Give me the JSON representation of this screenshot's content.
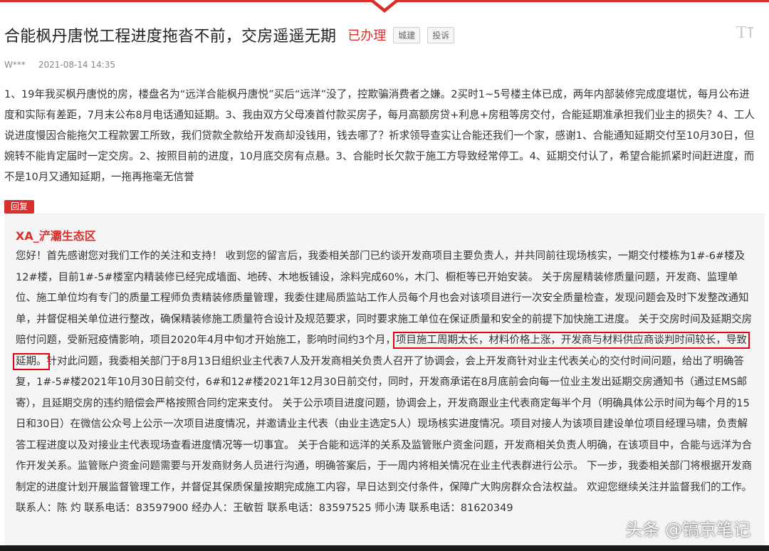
{
  "header": {
    "title": "合能枫丹唐悦工程进度拖沓不前，交房遥遥无期",
    "status": "已办理",
    "tags": [
      "城建",
      "投诉"
    ],
    "font_toggle_label": "T"
  },
  "meta": {
    "author": "W***",
    "timestamp": "2021-08-14 14:35"
  },
  "question": {
    "body": "1、19年我买枫丹唐悦的房，楼盘名为“远洋合能枫丹唐悦”买后“远洋”没了，控欺骗消费者之嫌。2买时1~5号楼主体已成，两年内部装修完成度堪忧，每月公布进度和实际有差距，7月末公布8月电话通知延期。3、我由双方父母凑首付款买房子，每月高额房贷+利息+房租等房交付，合能延期准承担我们业主的损失？4、工人说进度慢因合能拖欠工程款罢工所致，我们贷款全款给开发商却没钱用，钱去哪了？祈求领导查实让合能还我们一个家，感谢1、合能通知延期交付至10月30日，但婉转不能肯定届时一定交房。2、按照目前的进度，10月底交房有点悬。3、合能时长欠款于施工方导致经常停工。4、延期交付认了，希望合能抓紧时间赶进度，而不是10月又通知延期，一拖再拖毫无信誉"
  },
  "reply": {
    "badge": "回复",
    "department": "XA_浐灞生态区",
    "text_before": "您好！首先感谢您对我们工作的关注和支持！ 收到您的留言后，我委相关部门已约谈开发商项目主要负责人，并共同前往现场核实，一期交付楼栋为1#-6#楼及12#楼，目前1#-5#楼室内精装修已经完成墙面、地砖、木地板铺设，涂料完成60%，木门、橱柜等已开始安装。 关于房屋精装修质量问题，开发商、监理单位、施工单位均有专门的质量工程师负责精装修质量管理，我委住建局质监站工作人员每个月也会对该项目进行一次安全质量检查，发现问题会及时下发整改通知单，并督促相关单位进行整改，确保精装修施工质量符合设计及规范要求，同时要求施工单位在保证质量和安全的前提下加快施工进度。 关于交房时间及延期交房赔付问题，受新冠疫情影响，项目2020年4月中旬才开始施工，影响时间约3个月，",
    "text_highlight": "项目施工周期太长，材料价格上涨，开发商与材料供应商谈判时间较长，导致延期。",
    "text_after": "针对此问题，我委相关部门于8月13日组织业主代表7人及开发商相关负责人召开了协调会，会上开发商针对业主代表关心的交付时间问题，给出了明确答复，1#-5#楼2021年10月30日前交付，6#和12#楼2021年12月30日前交付，同时，开发商承诺在8月底前会向每一位业主发出延期交房通知书（通过EMS邮寄），且延期交房的违约赔偿会严格按照合同约定来支付。 关于公示项目进度问题，协调会上，开发商跟业主代表商定每半个月（明确具体公示时间为每个月的15日和30日）在微信公众号上公示一次项目进度情况，并邀请业主代表（由业主选定5人）现场核实进度情况。项目对接人为该项目建设单位项目经理马啸，负责解答工程进度以及对接业主代表现场查看进度情况等一切事宜。 关于合能和远洋的关系及监管账户资金问题，开发商相关负责人明确，在该项目中，合能与远洋为合作开发关系。监管账户资金问题需要与开发商财务人员进行沟通，明确答案后，于一周内将相关情况在业主代表群进行公示。 下一步，我委相关部门将根据开发商制定的进度计划开展监督管理工作，并督促其保质保量按期完成施工内容，早日达到交付条件，保障广大购房群众合法权益。 欢迎您继续关注并监督我们的工作。 联系人：陈 灼 联系电话：83597900 经办人：王敏哲 联系电话：83597525 师小涛 联系电话：81620349"
  },
  "watermark": "头条 @镐京笔记",
  "colors": {
    "accent": "#d9302e",
    "highlight_border": "#e60012"
  }
}
